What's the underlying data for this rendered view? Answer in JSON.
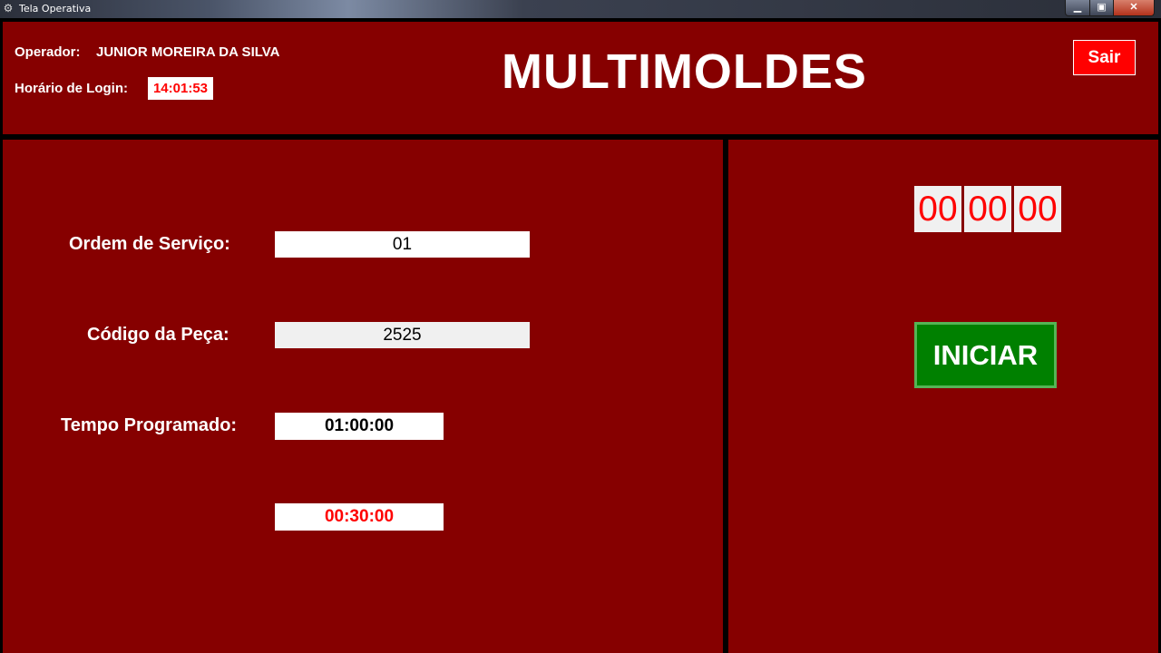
{
  "window": {
    "title": "Tela Operativa",
    "icon": "app-icon",
    "controls": {
      "minimize": "▁",
      "maximize": "▣",
      "close": "✕"
    }
  },
  "header": {
    "operator_label": "Operador:",
    "operator_name": "JUNIOR MOREIRA DA SILVA",
    "login_label": "Horário de Login:",
    "login_time": "14:01:53",
    "brand": "MULTIMOLDES",
    "exit_label": "Sair"
  },
  "form": {
    "os_label": "Ordem de Serviço:",
    "os_value": "01",
    "part_label": "Código da Peça:",
    "part_value": "2525",
    "time_label": "Tempo Programado:",
    "time_value": "01:00:00",
    "remaining_value": "00:30:00"
  },
  "timer": {
    "hours": "00",
    "minutes": "00",
    "seconds": "00",
    "start_label": "INICIAR"
  },
  "colors": {
    "panel": "#860000",
    "accent_red": "#ff0000",
    "start_green": "#008000"
  }
}
